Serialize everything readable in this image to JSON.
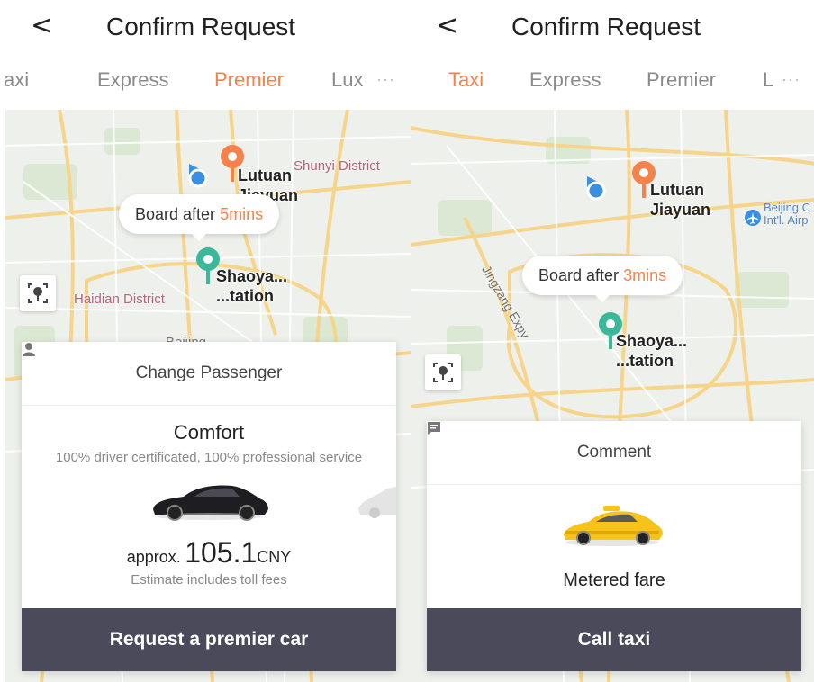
{
  "left": {
    "header": {
      "back_symbol": "<",
      "title": "Confirm Request"
    },
    "tabs": [
      {
        "label": "Taxi"
      },
      {
        "label": "Express"
      },
      {
        "label": "Premier",
        "active": true
      },
      {
        "label": "Lux"
      }
    ],
    "tabs_overflow": "···",
    "map": {
      "board_prefix": "Board after ",
      "board_time": "5mins",
      "districts": [
        "Shunyi District",
        "Haidian District",
        "Beijing"
      ],
      "places": {
        "destination_line1": "Lutuan",
        "destination_line2": "Jiayuan",
        "pickup_line1": "Shaoya...",
        "pickup_line2": "...tation"
      }
    },
    "card": {
      "change_passenger": "Change Passenger",
      "car_class": "Comfort",
      "car_description": "100% driver certificated, 100% professional service",
      "price_prefix": "approx.",
      "price_value": "105.1",
      "price_unit": "CNY",
      "price_note": "Estimate includes toll fees",
      "cta_label": "Request a premier car"
    }
  },
  "right": {
    "header": {
      "back_symbol": "<",
      "title": "Confirm Request"
    },
    "tabs": [
      {
        "label": "Taxi",
        "active": true
      },
      {
        "label": "Express"
      },
      {
        "label": "Premier"
      },
      {
        "label": "L"
      }
    ],
    "tabs_overflow": "···",
    "map": {
      "board_prefix": "Board after ",
      "board_time": "3mins",
      "road_label": "Jingzang Expy",
      "airport_label_line1": "Beijing C",
      "airport_label_line2": "Int'l. Airp",
      "places": {
        "destination_line1": "Lutuan",
        "destination_line2": "Jiayuan",
        "pickup_line1": "Shaoya...",
        "pickup_line2": "...tation"
      }
    },
    "card": {
      "comment": "Comment",
      "fare_label": "Metered fare",
      "cta_label": "Call taxi"
    }
  },
  "colors": {
    "accent": "#f5824a",
    "pickup_pin": "#3bb89a",
    "user_dot": "#3a8fe0",
    "cta_bg": "#4a4a5a"
  }
}
